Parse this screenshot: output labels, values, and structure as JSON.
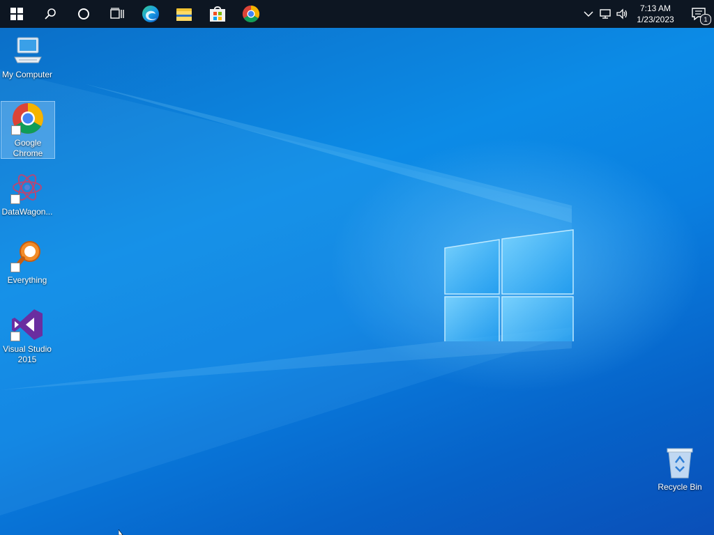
{
  "taskbar": {
    "items": [
      {
        "name": "start-button",
        "icon": "windows-logo-icon"
      },
      {
        "name": "search-button",
        "icon": "search-icon"
      },
      {
        "name": "cortana-button",
        "icon": "circle-icon"
      },
      {
        "name": "task-view-button",
        "icon": "task-view-icon"
      },
      {
        "name": "edge-button",
        "icon": "edge-icon"
      },
      {
        "name": "file-explorer-button",
        "icon": "folder-icon"
      },
      {
        "name": "store-button",
        "icon": "store-icon"
      },
      {
        "name": "chrome-button",
        "icon": "chrome-icon"
      }
    ],
    "tray": {
      "time": "7:13 AM",
      "date": "1/23/2023",
      "notification_count": "1"
    }
  },
  "desktop": {
    "icons": [
      {
        "label": "My Computer",
        "icon": "computer-icon"
      },
      {
        "label": "Google Chrome",
        "icon": "chrome-icon"
      },
      {
        "label": "DataWagon...",
        "icon": "datawagon-icon"
      },
      {
        "label": "Everything",
        "icon": "everything-icon"
      },
      {
        "label": "Visual Studio 2015",
        "icon": "visual-studio-icon"
      },
      {
        "label": "Recycle Bin",
        "icon": "recycle-bin-icon"
      }
    ]
  },
  "colors": {
    "taskbar": "#0d1622",
    "wallpaper": "#0a7fd6",
    "accent": "#2aa4ff"
  }
}
